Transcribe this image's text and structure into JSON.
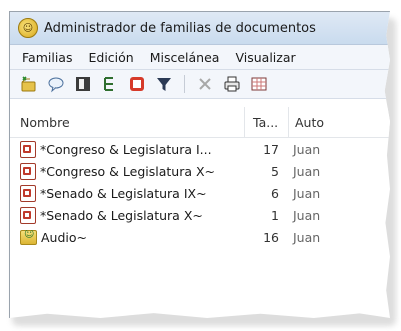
{
  "window": {
    "title": "Administrador de familias de documentos"
  },
  "menubar": {
    "items": [
      "Familias",
      "Edición",
      "Miscelánea",
      "Visualizar"
    ]
  },
  "toolbar": {
    "icons": [
      "new-family-icon",
      "comment-icon",
      "open-icon",
      "tree-icon",
      "stop-icon",
      "filter-icon",
      "delete-icon",
      "print-icon",
      "grid-icon"
    ]
  },
  "list": {
    "columns": [
      "Nombre",
      "Ta...",
      "Auto"
    ],
    "rows": [
      {
        "name": "*Congreso & Legislatura I...",
        "count": "17",
        "author": "Juan",
        "icon": "document-family-icon"
      },
      {
        "name": "*Congreso & Legislatura X~",
        "count": "5",
        "author": "Juan",
        "icon": "document-family-icon"
      },
      {
        "name": "*Senado & Legislatura IX~",
        "count": "6",
        "author": "Juan",
        "icon": "document-family-icon"
      },
      {
        "name": "*Senado & Legislatura X~",
        "count": "1",
        "author": "Juan",
        "icon": "document-family-icon"
      },
      {
        "name": "Audio~",
        "count": "16",
        "author": "Juan",
        "icon": "audio-family-icon"
      }
    ]
  }
}
